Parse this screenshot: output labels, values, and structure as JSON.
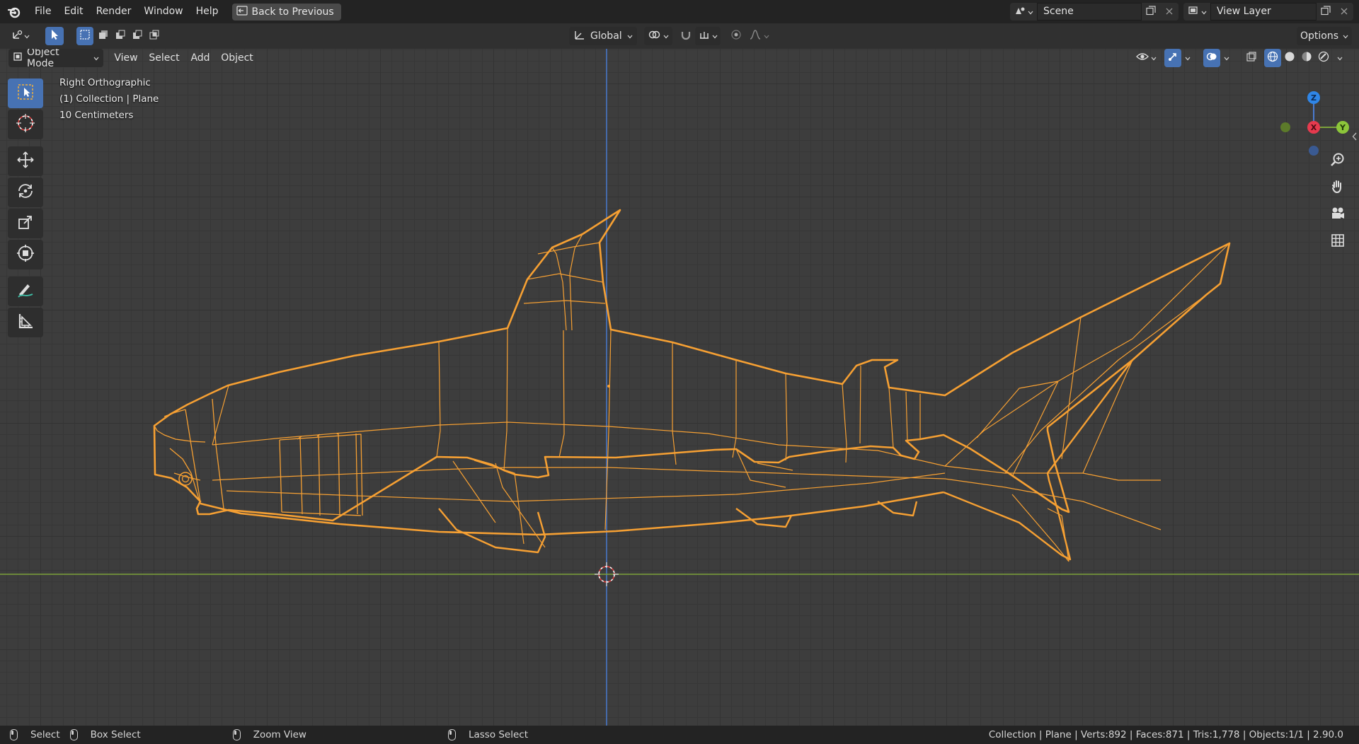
{
  "menu": {
    "items": [
      "File",
      "Edit",
      "Render",
      "Window",
      "Help"
    ],
    "back_button": "Back to Previous"
  },
  "scene": {
    "label": "Scene"
  },
  "view_layer": {
    "label": "View Layer"
  },
  "header": {
    "transform_orientation": "Global",
    "options": "Options",
    "mode": "Object Mode",
    "menus": [
      "View",
      "Select",
      "Add",
      "Object"
    ]
  },
  "viewport": {
    "view_name": "Right Orthographic",
    "collection_info": "(1) Collection | Plane",
    "scale_info": "10 Centimeters",
    "axes": {
      "z": "Z",
      "x": "X",
      "y": "Y"
    },
    "colors": {
      "wire": "#f6a033",
      "y_axis_line": "#7ca23a",
      "z_axis_line": "#4a7bd0",
      "accent": "#4772b3"
    }
  },
  "toolbar": {
    "tools": [
      "select-box-icon",
      "cursor-icon",
      "move-icon",
      "rotate-icon",
      "scale-icon",
      "transform-icon",
      "annotate-icon",
      "measure-icon"
    ]
  },
  "statusbar": {
    "select": "Select",
    "box_select": "Box Select",
    "zoom_view": "Zoom View",
    "lasso_select": "Lasso Select",
    "stats": "Collection | Plane | Verts:892 | Faces:871 | Tris:1,778 | Objects:1/1 | 2.90.0"
  }
}
